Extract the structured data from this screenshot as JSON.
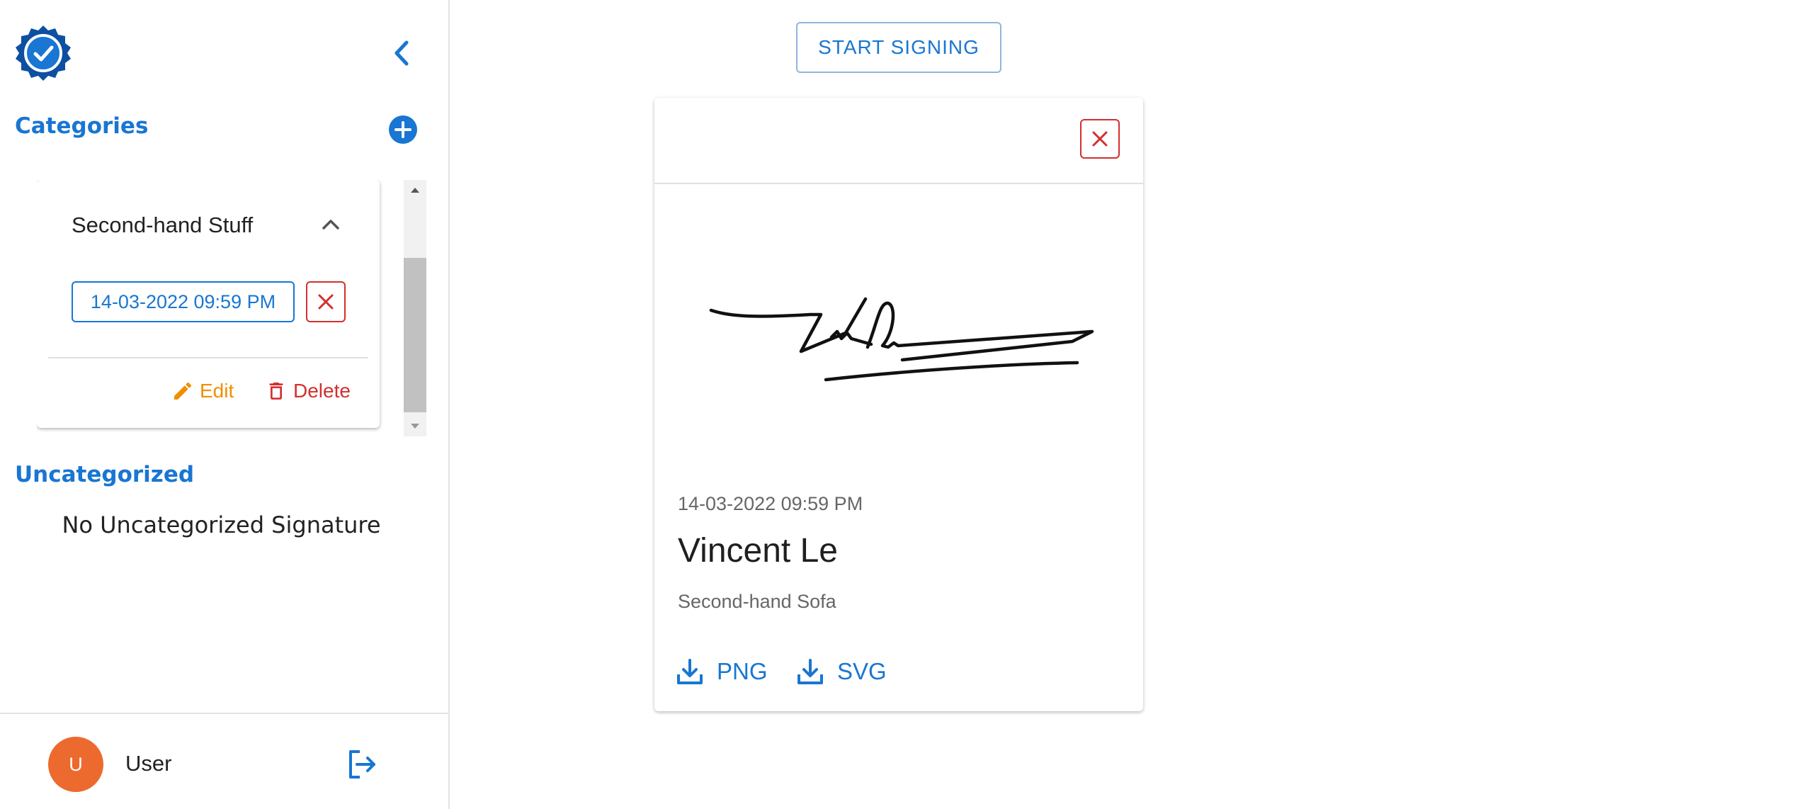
{
  "sidebar": {
    "categories_title": "Categories",
    "category": {
      "name": "Second-hand Stuff",
      "signature_chip": "14-03-2022 09:59 PM",
      "edit_label": "Edit",
      "delete_label": "Delete"
    },
    "uncategorized_title": "Uncategorized",
    "uncategorized_empty": "No Uncategorized Signature",
    "user": {
      "avatar_letter": "U",
      "name": "User"
    }
  },
  "main": {
    "start_button": "START SIGNING",
    "signature_card": {
      "date": "14-03-2022 09:59 PM",
      "signer": "Vincent Le",
      "category": "Second-hand Sofa",
      "download_png": "PNG",
      "download_svg": "SVG"
    }
  },
  "colors": {
    "primary": "#1976d2",
    "danger": "#d32f2f",
    "edit": "#ef8f00",
    "avatar": "#ed6a2f"
  },
  "icons": {
    "logo": "verified-badge-icon",
    "collapse": "chevron-left-icon",
    "add": "add-circle-icon",
    "expand": "chevron-up-icon",
    "remove": "close-icon",
    "edit": "pencil-icon",
    "delete": "trash-icon",
    "logout": "logout-icon",
    "download": "download-icon"
  }
}
